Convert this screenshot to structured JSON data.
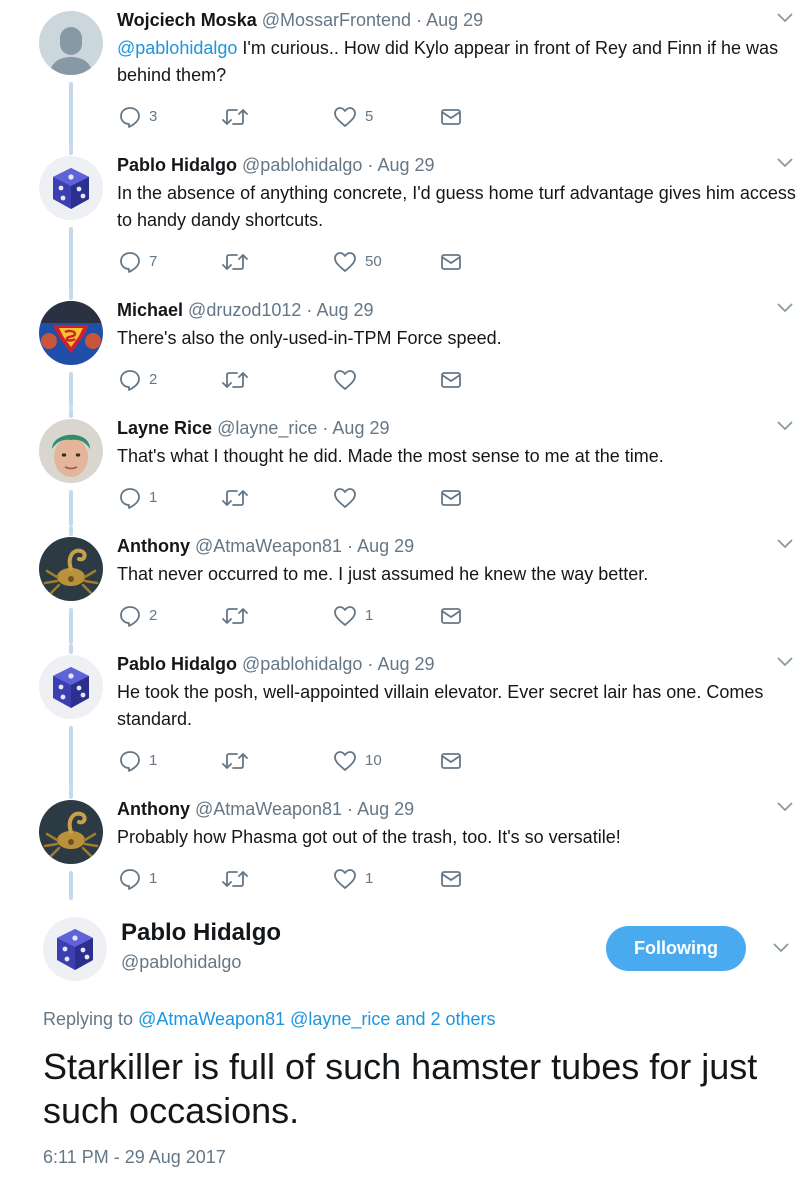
{
  "tweets": [
    {
      "name": "Wojciech Moska",
      "handle": "@MossarFrontend",
      "sep": "·",
      "date": "Aug 29",
      "mention": "@pablohidalgo",
      "text": " I'm curious.. How did Kylo appear in front of Rey and Finn if he was behind them?",
      "replies": "3",
      "retweets": "",
      "likes": "5",
      "avatar": "default-avatar"
    },
    {
      "name": "Pablo Hidalgo",
      "handle": "@pablohidalgo",
      "sep": "·",
      "date": "Aug 29",
      "mention": "",
      "text": "In the absence of anything concrete, I'd guess home turf advantage gives him access to handy dandy shortcuts.",
      "replies": "7",
      "retweets": "",
      "likes": "50",
      "avatar": "dice-avatar"
    },
    {
      "name": "Michael",
      "handle": "@druzod1012",
      "sep": "·",
      "date": "Aug 29",
      "mention": "",
      "text": "There's also the only-used-in-TPM Force speed.",
      "replies": "2",
      "retweets": "",
      "likes": "",
      "avatar": "superman-avatar"
    },
    {
      "name": "Layne Rice",
      "handle": "@layne_rice",
      "sep": "·",
      "date": "Aug 29",
      "mention": "",
      "text": "That's what I thought he did. Made the most sense to me at the time.",
      "replies": "1",
      "retweets": "",
      "likes": "",
      "avatar": "face-avatar"
    },
    {
      "name": "Anthony",
      "handle": "@AtmaWeapon81",
      "sep": "·",
      "date": "Aug 29",
      "mention": "",
      "text": "That never occurred to me. I just assumed he knew the way better.",
      "replies": "2",
      "retweets": "",
      "likes": "1",
      "avatar": "scorpion-avatar"
    },
    {
      "name": "Pablo Hidalgo",
      "handle": "@pablohidalgo",
      "sep": "·",
      "date": "Aug 29",
      "mention": "",
      "text": "He took the posh, well-appointed villain elevator. Ever secret lair has one. Comes standard.",
      "replies": "1",
      "retweets": "",
      "likes": "10",
      "avatar": "dice-avatar"
    },
    {
      "name": "Anthony",
      "handle": "@AtmaWeapon81",
      "sep": "·",
      "date": "Aug 29",
      "mention": "",
      "text": "Probably how Phasma got out of the trash, too. It's so versatile!",
      "replies": "1",
      "retweets": "",
      "likes": "1",
      "avatar": "scorpion-avatar"
    }
  ],
  "main": {
    "name": "Pablo Hidalgo",
    "handle": "@pablohidalgo",
    "follow_label": "Following",
    "replying_prefix": "Replying to ",
    "replying_mention1": "@AtmaWeapon81",
    "replying_space": " ",
    "replying_mention2": "@layne_rice",
    "replying_suffix": " and 2 others",
    "text": "Starkiller is full of such hamster tubes for just such occasions.",
    "timestamp": "6:11 PM - 29 Aug 2017",
    "avatar": "dice-avatar"
  },
  "colors": {
    "accent": "#1b95e0",
    "follow_bg": "#4aaaf0",
    "muted": "#657786",
    "thread_line": "#c4d9ec"
  }
}
